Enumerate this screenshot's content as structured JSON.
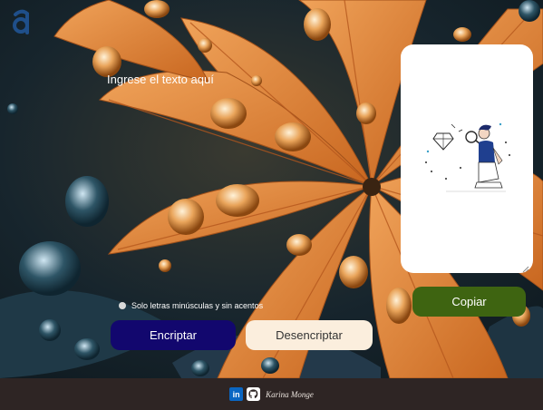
{
  "brand": {
    "logo_letter": "a",
    "accent": "#1f4f8a"
  },
  "input": {
    "placeholder": "Ingrese el texto aquí"
  },
  "hint": {
    "text": "Solo letras minúsculas y sin acentos",
    "icon": "info-icon"
  },
  "buttons": {
    "encrypt_label": "Encriptar",
    "decrypt_label": "Desencriptar",
    "copy_label": "Copiar"
  },
  "output": {
    "illustration": "person-with-magnifier-illustration"
  },
  "footer": {
    "linkedin_label": "in",
    "github_icon": "github-icon",
    "author": "Karina Monge"
  },
  "colors": {
    "encrypt_bg": "#12076e",
    "decrypt_bg": "#fbeedd",
    "copy_bg": "#3e6411",
    "footer_bg": "#2e2524"
  }
}
